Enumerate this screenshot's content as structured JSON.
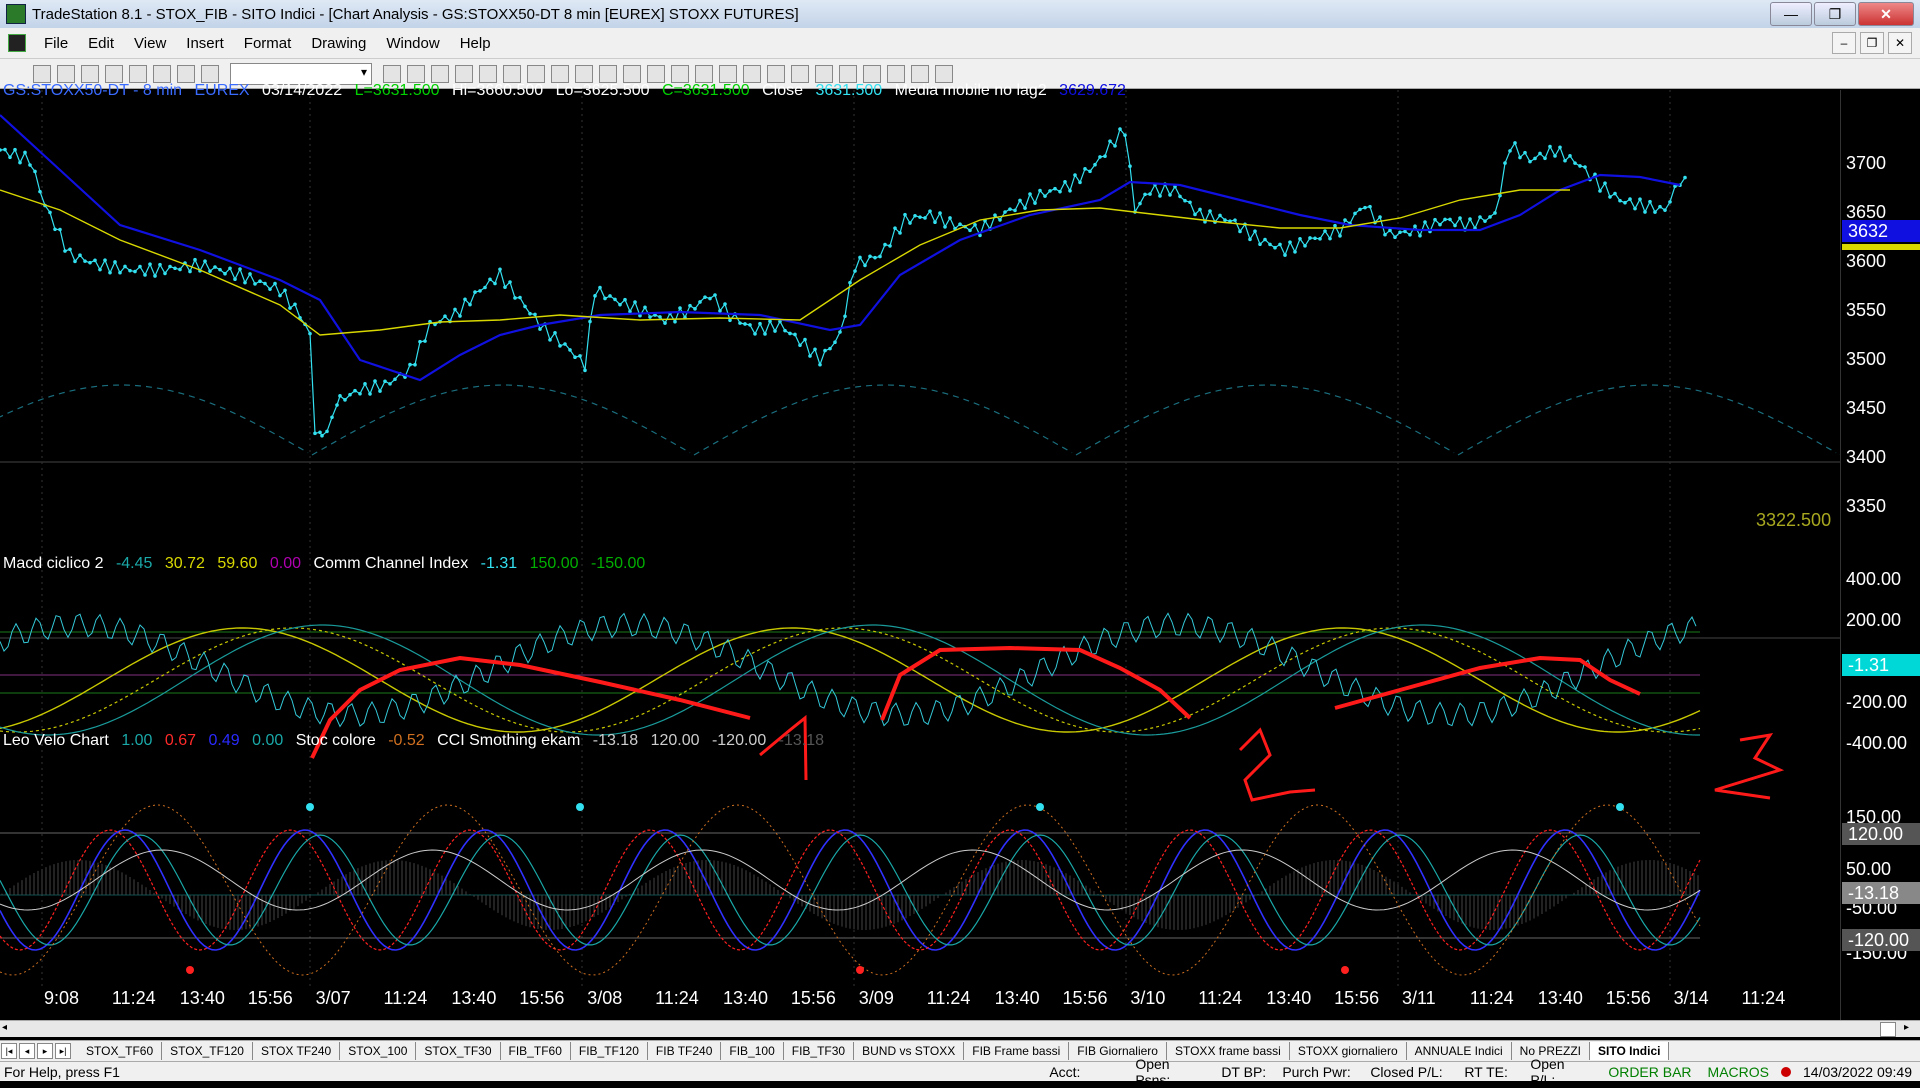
{
  "window": {
    "title": "TradeStation 8.1 - STOX_FIB - SITO Indici - [Chart Analysis - GS:STOXX50-DT  8 min  [EUREX] STOXX FUTURES]",
    "buttons": {
      "minimize": "—",
      "maximize": "❐",
      "close": "✕"
    }
  },
  "menu": [
    "File",
    "Edit",
    "View",
    "Insert",
    "Format",
    "Drawing",
    "Window",
    "Help"
  ],
  "mdi_buttons": [
    "–",
    "❐",
    "✕"
  ],
  "toolbar_icons": [
    "new-icon",
    "open-icon",
    "save-icon",
    "print-icon",
    "chart-icon",
    "grid-icon",
    "lock-icon",
    "workspace-icon",
    "zoom-in-icon",
    "zoom-out-icon",
    "cursor-icon",
    "trendline-icon",
    "arrow-up-icon",
    "arrow-down-icon",
    "circle-icon",
    "rect-icon",
    "text-icon"
  ],
  "price_legend": {
    "symbol": "GS:STOXX50-DT - 8 min",
    "exchange": "EUREX",
    "date": "03/14/2022",
    "low_open": "L=3631.500",
    "hi": "Hi=3660.500",
    "lo": "Lo=3625.500",
    "close_c": "C=3631.500",
    "close_label": "Close",
    "close_val": "3631.500",
    "ma_label": "Media mobile no lag2",
    "ma_val": "3629.672"
  },
  "macd_legend": {
    "name": "Macd ciclico 2",
    "v1": "-4.45",
    "v2": "30.72",
    "v3": "59.60",
    "v4": "0.00",
    "cci_name": "Comm Channel Index",
    "c1": "-1.31",
    "c2": "150.00",
    "c3": "-150.00"
  },
  "velo_legend": {
    "name": "Leo Velo Chart",
    "v1": "1.00",
    "v2": "0.67",
    "v3": "0.49",
    "v4": "0.00",
    "stoc": "Stoc colore",
    "stoc_val": "-0.52",
    "cci_s": "CCI Smothing ekam",
    "s1": "-13.18",
    "s2": "120.00",
    "s3": "-120.00",
    "s4": "-13.18"
  },
  "price_axis": [
    "3700",
    "3650",
    "3600",
    "3550",
    "3500",
    "3450",
    "3400",
    "3350"
  ],
  "price_current": "3632",
  "price_dashed_label": "3322.500",
  "macd_axis": [
    "400.00",
    "200.00",
    "-200.00",
    "-400.00"
  ],
  "macd_current": "-1.31",
  "velo_axis": [
    "150.00",
    "120.00",
    "50.00",
    "-50.00",
    "-150.00"
  ],
  "velo_current_top": "120.00",
  "velo_current_mid": "-13.18",
  "velo_current_bot": "-120.00",
  "time_axis": [
    "9:08",
    "11:24",
    "13:40",
    "15:56",
    "3/07",
    "11:24",
    "13:40",
    "15:56",
    "3/08",
    "11:24",
    "13:40",
    "15:56",
    "3/09",
    "11:24",
    "13:40",
    "15:56",
    "3/10",
    "11:24",
    "13:40",
    "15:56",
    "3/11",
    "11:24",
    "13:40",
    "15:56",
    "3/14",
    "11:24"
  ],
  "tabs": [
    "STOX_TF60",
    "STOX_TF120",
    "STOX TF240",
    "STOX_100",
    "STOX_TF30",
    "FIB_TF60",
    "FIB_TF120",
    "FIB TF240",
    "FIB_100",
    "FIB_TF30",
    "BUND vs STOXX",
    "FIB Frame bassi",
    "FIB Giornaliero",
    "STOXX frame bassi",
    "STOXX giornaliero",
    "ANNUALE Indici",
    "No PREZZI",
    "SITO Indici"
  ],
  "active_tab": "SITO Indici",
  "status": {
    "help": "For Help, press F1",
    "acct": "Acct:",
    "open_psns": "Open Psns:",
    "dt_bp": "DT BP:",
    "purch_pwr": "Purch Pwr:",
    "closed_pl": "Closed P/L:",
    "rt_te": "RT TE:",
    "open_pl": "Open P/L:",
    "order_bar": "ORDER BAR",
    "macros": "MACROS",
    "datetime": "14/03/2022 09:49"
  },
  "colors": {
    "price_dots": "#33e0f0",
    "ma_blue": "#1010e0",
    "ma_yellow": "#d8d800",
    "annotation_red": "#ff1a1a",
    "legend_symbol": "#3a6bff",
    "legend_green": "#00d000"
  }
}
